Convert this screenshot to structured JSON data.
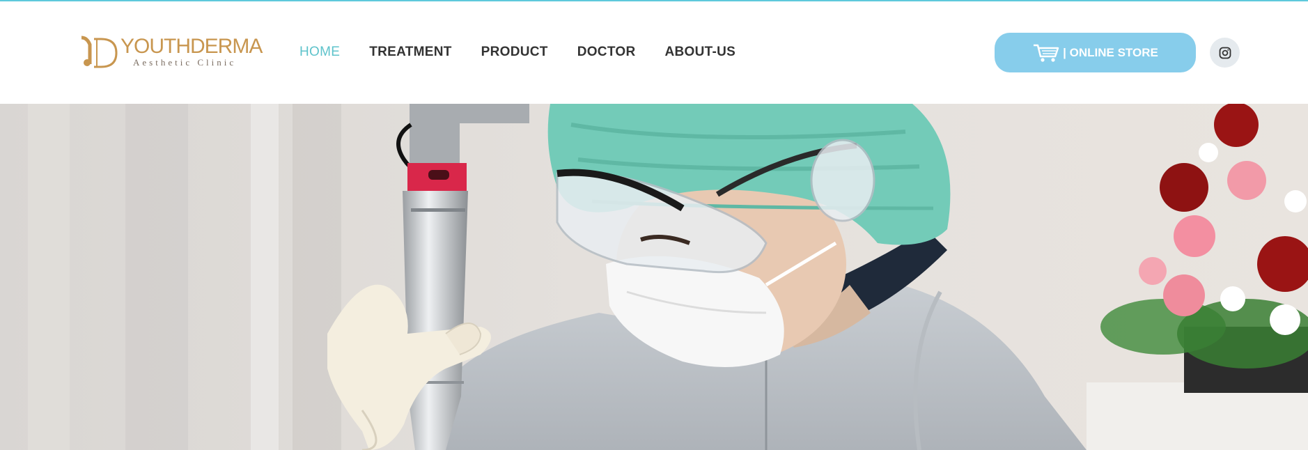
{
  "brand": {
    "name": "YOUTHDERMA",
    "tagline": "Aesthetic Clinic",
    "mark": "YD",
    "logo_color": "#c8964f"
  },
  "nav": {
    "items": [
      {
        "label": "HOME",
        "active": true
      },
      {
        "label": "TREATMENT",
        "active": false
      },
      {
        "label": "PRODUCT",
        "active": false
      },
      {
        "label": "DOCTOR",
        "active": false
      },
      {
        "label": "ABOUT-US",
        "active": false
      }
    ],
    "active_color": "#5ec3cb"
  },
  "actions": {
    "store_label": "| ONLINE STORE",
    "store_icon": "shopping-cart-icon",
    "store_color": "#87cdeb",
    "social_icon": "instagram-icon"
  },
  "hero": {
    "image_subject": "technician-with-laser-device-photo"
  }
}
